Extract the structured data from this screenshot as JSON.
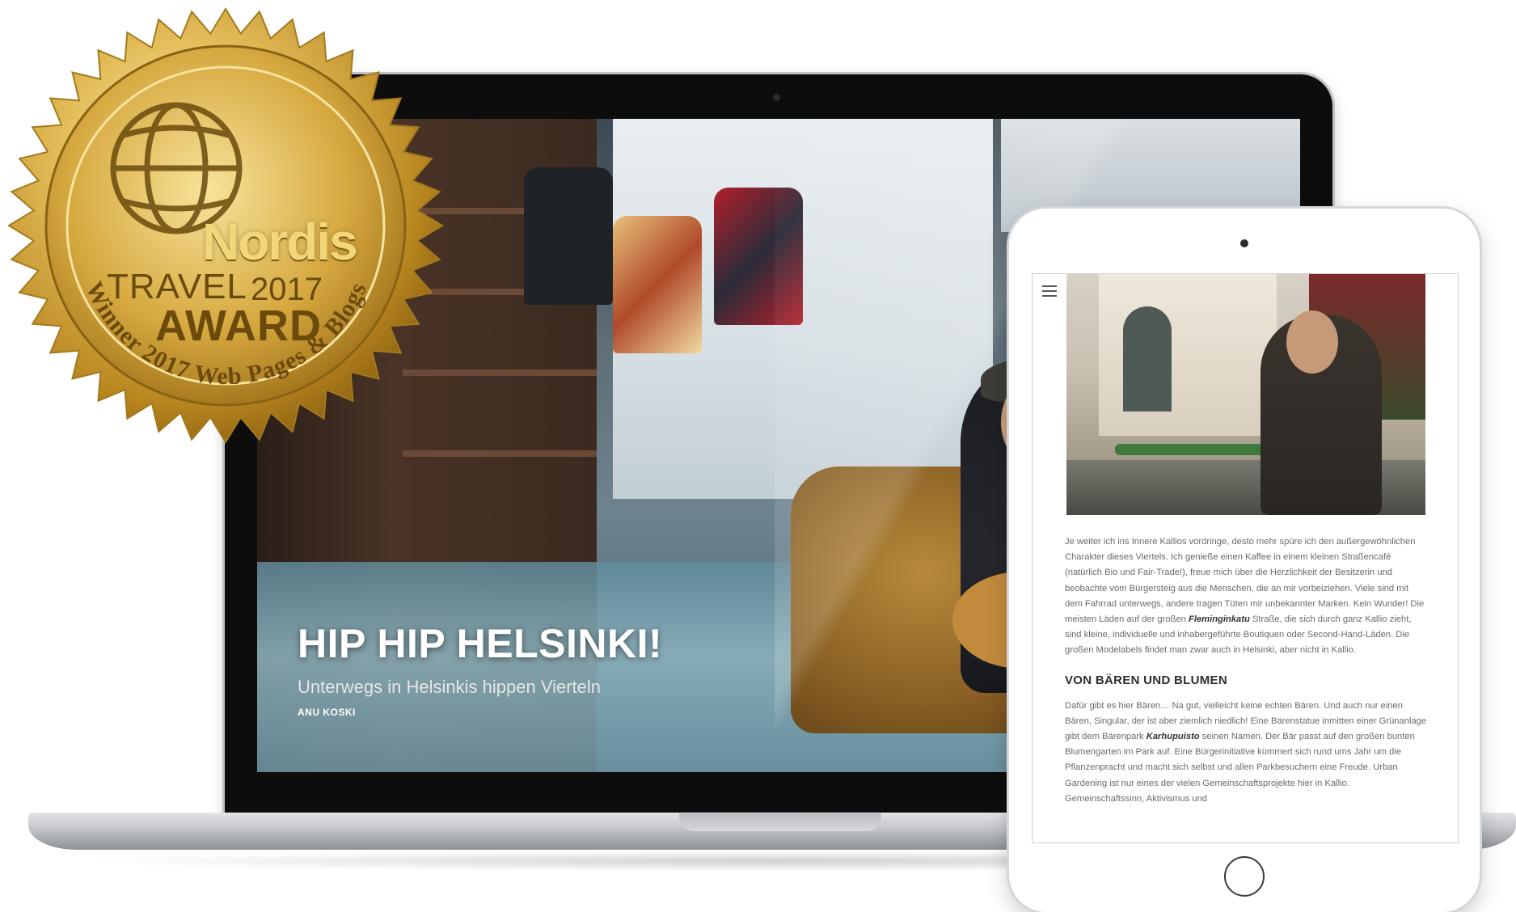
{
  "badge": {
    "brand": "Nordis",
    "line_travel": "TRAVEL",
    "year": "2017",
    "line_award": "AWARD",
    "arc_text": "Winner 2017 Web Pages & Blogs",
    "colors": {
      "gold_light": "#f3d67a",
      "gold_dark": "#6b4a0c",
      "gold_mid": "#c89b2e"
    }
  },
  "laptop": {
    "hero": {
      "title": "HIP HIP HELSINKI!",
      "subtitle": "Unterwegs in Helsinkis hippen Vierteln",
      "author": "ANU KOSKI"
    }
  },
  "tablet": {
    "menu_icon": "hamburger-menu-icon",
    "paragraph_1_a": "Je weiter ich ins Innere Kallios vordringe, desto mehr spüre ich den außergewöhnlichen Charakter dieses Viertels. Ich genieße einen Kaffee in einem kleinen Straßencafé (natürlich Bio und Fair-Trade!), freue mich über die Herzlichkeit der Besitzerin und beobachte vom Bürgersteig aus die Menschen, die an mir vorbeiziehen. Viele sind mit dem Fahrrad unterwegs, andere tragen Tüten mir unbekannter Marken. Kein Wunder! Die meisten Läden auf der großen ",
    "paragraph_1_bold": "Fleminginkatu",
    "paragraph_1_b": " Straße, die sich durch ganz Kallio zieht, sind kleine, individuelle und inhabergeführte Boutiquen oder Second-Hand-Läden. Die großen Modelabels findet man zwar auch in Helsinki, aber nicht in Kallio.",
    "heading": "VON BÄREN UND BLUMEN",
    "paragraph_2_a": "Dafür gibt es hier Bären… Na gut, vielleicht keine echten Bären. Und auch nur einen Bären, Singular, der ist aber ziemlich niedlich! Eine Bärenstatue inmitten einer Grünanlage gibt dem Bärenpark ",
    "paragraph_2_bold": "Karhupuisto",
    "paragraph_2_b": " seinen Namen. Der Bär passt auf den großen bunten Blumengarten im Park auf. Eine Bürgerinitiative kümmert sich rund ums Jahr um die Pflanzenpracht und macht sich selbst und allen Parkbesuchern eine Freude. Urban Gardening ist nur eines der vielen Gemeinschaftsprojekte hier in Kallio. Gemeinschaftssinn, Aktivismus und"
  }
}
